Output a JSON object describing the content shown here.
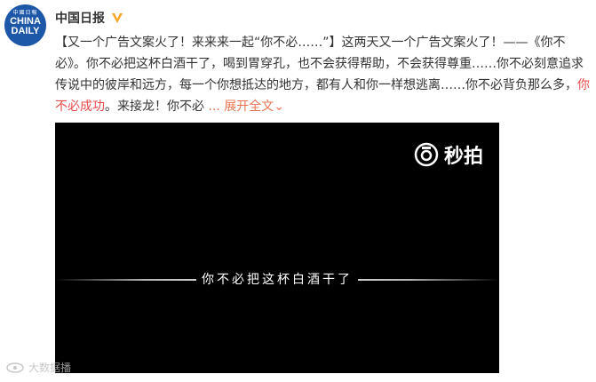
{
  "avatar": {
    "small_text": "中國日報",
    "brand_line1": "CHINA",
    "brand_line2": "DAILY"
  },
  "post": {
    "username": "中国日报",
    "body_part1": "【又一个广告文案火了！来来来一起“你不必……”】这两天又一个广告文案火了！——《你不必》。你不必把这杯白酒干了，喝到胃穿孔，也不会获得帮助，不会获得尊重……你不必刻意追求传说中的彼岸和远方，每一个你想抵达的地方，都有人和你一样想逃离……你不必背负那么多，",
    "body_part2_red": "你不必成功",
    "body_part3": "。来接龙！你不必",
    "ellipsis": " ... ",
    "expand_label": "展开全文",
    "expand_arrow": "⌄"
  },
  "video": {
    "watermark_text": "秒拍",
    "subtitle": "你不必把这杯白酒干了"
  },
  "bottom_watermark": {
    "text": "大数据播"
  }
}
